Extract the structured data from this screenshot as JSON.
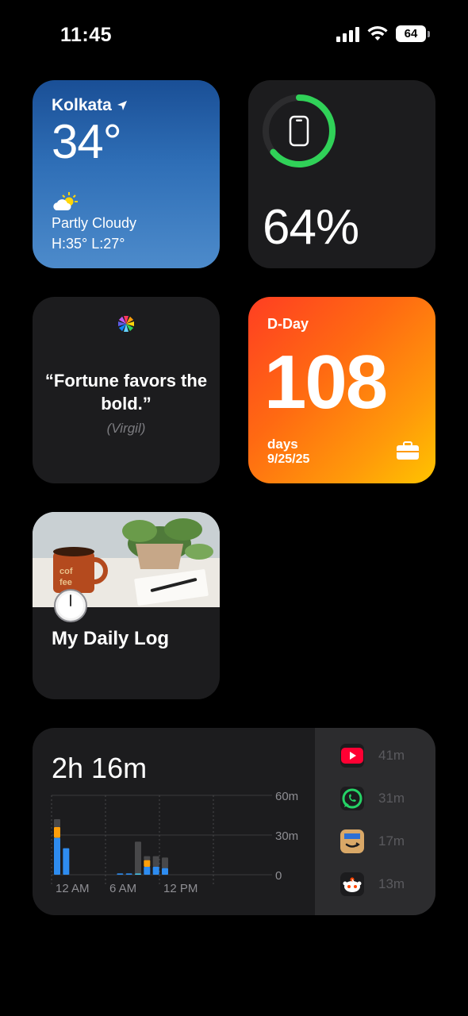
{
  "status_bar": {
    "time": "11:45",
    "battery": "64"
  },
  "weather": {
    "city": "Kolkata",
    "temperature": "34°",
    "condition": "Partly Cloudy",
    "high_low": "H:35° L:27°"
  },
  "battery_widget": {
    "percent_text": "64%",
    "level": 0.64,
    "ring_color": "#30d158"
  },
  "quote": {
    "text": "“Fortune favors the bold.”",
    "author": "(Virgil)"
  },
  "dday": {
    "label": "D-Day",
    "count": "108",
    "unit": "days",
    "date": "9/25/25"
  },
  "daily_log": {
    "title": "My Daily Log"
  },
  "screen_time": {
    "total": "2h 16m",
    "apps": [
      {
        "name": "YouTube",
        "icon": "youtube-icon",
        "time": "41m",
        "color": "#ff0033"
      },
      {
        "name": "WhatsApp",
        "icon": "whatsapp-icon",
        "time": "31m",
        "color": "#25d366"
      },
      {
        "name": "Amazon",
        "icon": "amazon-icon",
        "time": "17m",
        "color": "#d9a867"
      },
      {
        "name": "Reddit",
        "icon": "reddit-icon",
        "time": "13m",
        "color": "#ff4500"
      }
    ]
  },
  "chart_data": {
    "type": "bar",
    "y_tick_labels": [
      "60m",
      "30m",
      "0"
    ],
    "x_tick_labels": [
      "12 AM",
      "6 AM",
      "12 PM"
    ],
    "ylim": [
      0,
      60
    ],
    "grid": true,
    "series": [
      {
        "color": "#2e8cf0",
        "values": [
          28,
          20,
          1,
          1,
          0,
          6,
          6,
          5
        ]
      },
      {
        "color": "#ff9f0a",
        "values": [
          8,
          0,
          0,
          0,
          0,
          5,
          0,
          0
        ]
      },
      {
        "color": "#48c8f0",
        "values": [
          0,
          0,
          0,
          0,
          1,
          0,
          0,
          0
        ]
      },
      {
        "color": "#48484a",
        "values": [
          6,
          0,
          0,
          0,
          24,
          3,
          8,
          8
        ]
      }
    ],
    "x_hours": [
      0,
      1,
      7,
      8,
      9,
      10,
      11,
      12
    ]
  }
}
